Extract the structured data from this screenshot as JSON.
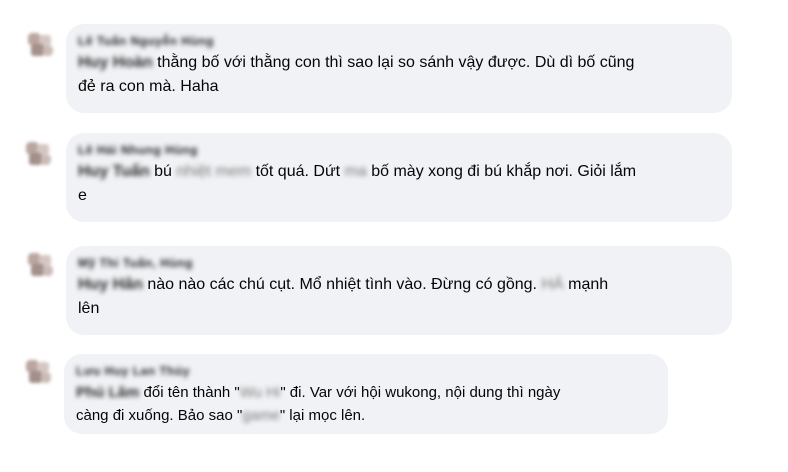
{
  "comments": [
    {
      "author": "Lê Tuấn Nguyễn Hùng",
      "mention": "Huy Hoàn",
      "text_a": "thằng bố với thằng con thì sao lại so sánh vậy được. Dù dì bố cũng",
      "text_b": "đẻ ra con mà. Haha"
    },
    {
      "author": "Lê Hải Nhung Hùng",
      "mention": "Huy Tuấn",
      "text_a": "bú",
      "censor_1": "nhiệt mem",
      "text_b": "tốt quá. Dứt",
      "censor_2": "ma",
      "text_c": "bố mày xong đi bú khắp nơi. Giỏi lắm",
      "text_d": "e"
    },
    {
      "author": "Mỹ Thi Tuấn, Hùng",
      "mention": "Huy Hân",
      "text_a": "nào nào các chú cụt. Mổ nhiệt tình vào. Đừng có gồng.",
      "censor_1": "HÁ",
      "text_b": "mạnh",
      "text_c": "lên"
    },
    {
      "author": "Lưu Huy Lan Thủy",
      "mention": "Phú Lâm",
      "text_a": "đổi tên thành \"",
      "censor_1": "Wu Hi",
      "text_b": "\" đi. Var với hội wukong, nội dung thì ngày",
      "text_c": "càng đi xuống. Bảo sao \"",
      "censor_2": "game",
      "text_d": "\" lại mọc lên."
    }
  ]
}
